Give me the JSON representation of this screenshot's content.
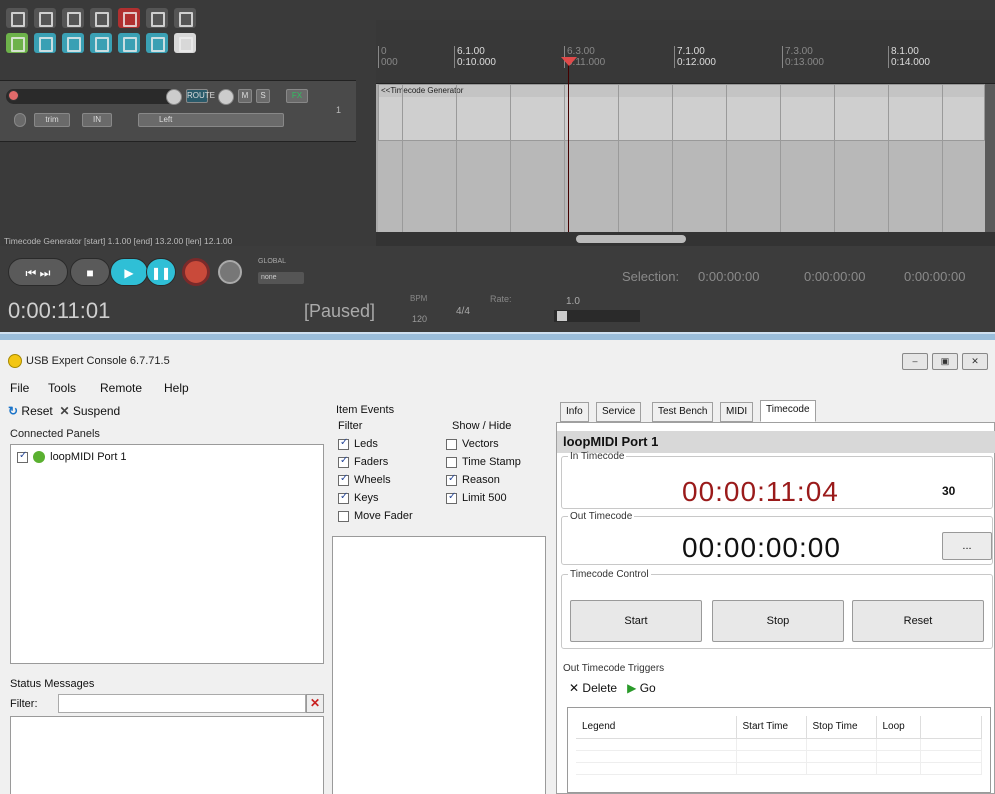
{
  "reaper": {
    "ruler_ticks": [
      {
        "bar": "0",
        "time": "000"
      },
      {
        "bar": "6.1.00",
        "time": "0:10.000"
      },
      {
        "bar": "6.3.00",
        "time": "0:11.000"
      },
      {
        "bar": "7.1.00",
        "time": "0:12.000"
      },
      {
        "bar": "7.3.00",
        "time": "0:13.000"
      },
      {
        "bar": "8.1.00",
        "time": "0:14.000"
      }
    ],
    "item_name": "<<Timecode Generator",
    "track_mini_labels": {
      "route": "ROUTE",
      "mute": "M",
      "solo": "S",
      "fx": "FX",
      "trim": "trim",
      "in": "IN",
      "input": "Left",
      "track_num": "1"
    },
    "status_line": "Timecode Generator [start] 1.1.00 [end] 13.2.00 [len] 12.1.00",
    "global_label": "GLOBAL",
    "global_value": "none",
    "time_display": "0:00:11:01",
    "play_state": "[Paused]",
    "bpm_label": "BPM",
    "bpm_value": "120",
    "time_sig": "4/4",
    "rate_label": "Rate:",
    "rate_value": "1.0",
    "selection_label": "Selection:",
    "selection_start": "0:00:00:00",
    "selection_end": "0:00:00:00",
    "selection_len": "0:00:00:00"
  },
  "console": {
    "title": "USB Expert Console 6.7.71.5",
    "win_controls": {
      "minimize": "–",
      "restore": "▣",
      "close": "✕"
    },
    "menu": [
      "File",
      "Tools",
      "Remote",
      "Help"
    ],
    "toolbar": {
      "reset": "Reset",
      "suspend": "Suspend"
    },
    "connected_panels_label": "Connected Panels",
    "connected_panels": [
      {
        "name": "loopMIDI Port 1",
        "checked": true
      }
    ],
    "status_messages_label": "Status Messages",
    "filter_label": "Filter:",
    "filter_value": "",
    "item_events": {
      "label": "Item Events",
      "filter_header": "Filter",
      "showhide_header": "Show / Hide",
      "filter": [
        {
          "label": "Leds",
          "checked": true
        },
        {
          "label": "Faders",
          "checked": true
        },
        {
          "label": "Wheels",
          "checked": true
        },
        {
          "label": "Keys",
          "checked": true
        },
        {
          "label": "Move Fader",
          "checked": false
        }
      ],
      "show_hide": [
        {
          "label": "Vectors",
          "checked": false
        },
        {
          "label": "Time Stamp",
          "checked": false
        },
        {
          "label": "Reason",
          "checked": true
        },
        {
          "label": "Limit 500",
          "checked": true
        }
      ]
    },
    "tabs": [
      "Info",
      "Service",
      "Test Bench",
      "MIDI",
      "Timecode"
    ],
    "active_tab": "Timecode",
    "port_title": "loopMIDI Port 1",
    "in_timecode_label": "In Timecode",
    "in_timecode": "00:00:11:04",
    "fps": "30",
    "out_timecode_label": "Out Timecode",
    "out_timecode": "00:00:00:00",
    "out_button": "...",
    "timecode_control_label": "Timecode Control",
    "buttons": {
      "start": "Start",
      "stop": "Stop",
      "reset": "Reset"
    },
    "triggers_label": "Out Timecode Triggers",
    "trigger_tools": {
      "delete": "Delete",
      "go": "Go"
    },
    "triggers_columns": [
      "Legend",
      "Start Time",
      "Stop Time",
      "Loop"
    ]
  }
}
